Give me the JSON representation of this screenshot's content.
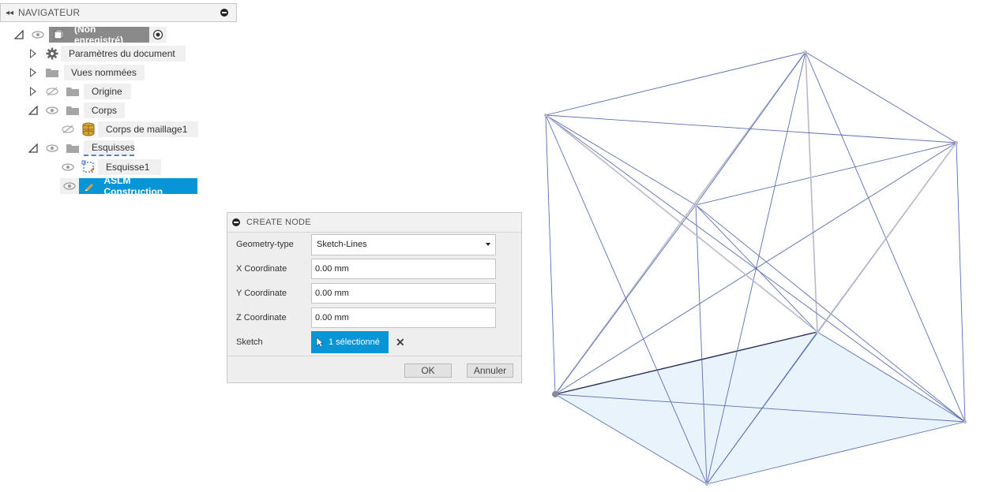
{
  "navigator": {
    "title": "NAVIGATEUR",
    "root_label": "(Non enregistré)",
    "items": [
      {
        "label": "Paramètres du document"
      },
      {
        "label": "Vues nommées"
      },
      {
        "label": "Origine"
      },
      {
        "label": "Corps"
      },
      {
        "label": "Corps de maillage1"
      },
      {
        "label": "Esquisses"
      },
      {
        "label": "Esquisse1"
      },
      {
        "label": "ASLM Construction"
      }
    ]
  },
  "dialog": {
    "title": "CREATE NODE",
    "geometry_type": {
      "label": "Geometry-type",
      "value": "Sketch-Lines"
    },
    "x": {
      "label": "X Coordinate",
      "value": "0.00 mm"
    },
    "y": {
      "label": "Y Coordinate",
      "value": "0.00 mm"
    },
    "z": {
      "label": "Z Coordinate",
      "value": "0.00 mm"
    },
    "sketch": {
      "label": "Sketch",
      "selection": "1 sélectionné"
    },
    "ok_label": "OK",
    "cancel_label": "Annuler"
  },
  "colors": {
    "accent": "#0696d7",
    "wire": "#5b6fb5",
    "face_fill": "#e8f3fb"
  }
}
